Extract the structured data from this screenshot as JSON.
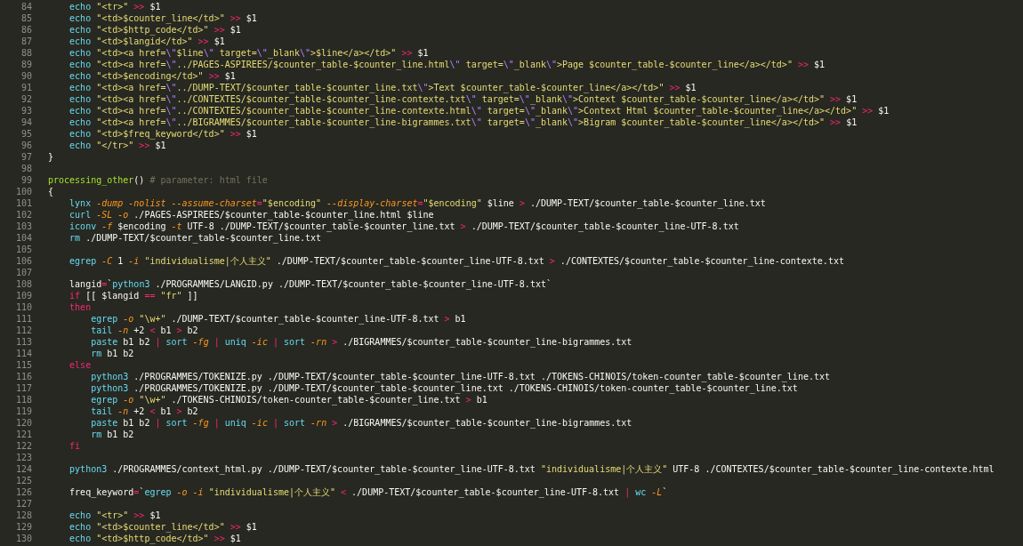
{
  "editor": {
    "lines": [
      {
        "number": "84",
        "tokens": [
          {
            "kind": "cmd",
            "text": "    echo"
          },
          {
            "kind": "str",
            "text": " \"<tr>\""
          },
          {
            "kind": "op",
            "text": " >>"
          },
          {
            "kind": "plain",
            "text": " $1"
          }
        ]
      },
      {
        "number": "85",
        "tokens": [
          {
            "kind": "cmd",
            "text": "    echo"
          },
          {
            "kind": "str",
            "text": " \"<td>$counter_line</td>\""
          },
          {
            "kind": "op",
            "text": " >>"
          },
          {
            "kind": "plain",
            "text": " $1"
          }
        ]
      },
      {
        "number": "86",
        "tokens": [
          {
            "kind": "cmd",
            "text": "    echo"
          },
          {
            "kind": "str",
            "text": " \"<td>$http_code</td>\""
          },
          {
            "kind": "op",
            "text": " >>"
          },
          {
            "kind": "plain",
            "text": " $1"
          }
        ]
      },
      {
        "number": "87",
        "tokens": [
          {
            "kind": "cmd",
            "text": "    echo"
          },
          {
            "kind": "str",
            "text": " \"<td>$langid</td>\""
          },
          {
            "kind": "op",
            "text": " >>"
          },
          {
            "kind": "plain",
            "text": " $1"
          }
        ]
      },
      {
        "number": "88",
        "tokens": [
          {
            "kind": "cmd",
            "text": "    echo"
          },
          {
            "kind": "str",
            "text": " \"<td><a href="
          },
          {
            "kind": "esc",
            "text": "\\\""
          },
          {
            "kind": "str",
            "text": "$line"
          },
          {
            "kind": "esc",
            "text": "\\\""
          },
          {
            "kind": "str",
            "text": " target="
          },
          {
            "kind": "esc",
            "text": "\\\""
          },
          {
            "kind": "str",
            "text": "_blank"
          },
          {
            "kind": "esc",
            "text": "\\\""
          },
          {
            "kind": "str",
            "text": ">$line</a></td>\""
          },
          {
            "kind": "op",
            "text": " >>"
          },
          {
            "kind": "plain",
            "text": " $1"
          }
        ]
      },
      {
        "number": "89",
        "tokens": [
          {
            "kind": "cmd",
            "text": "    echo"
          },
          {
            "kind": "str",
            "text": " \"<td><a href="
          },
          {
            "kind": "esc",
            "text": "\\\""
          },
          {
            "kind": "str",
            "text": "../PAGES-ASPIREES/$counter_table-$counter_line.html"
          },
          {
            "kind": "esc",
            "text": "\\\""
          },
          {
            "kind": "str",
            "text": " target="
          },
          {
            "kind": "esc",
            "text": "\\\""
          },
          {
            "kind": "str",
            "text": "_blank"
          },
          {
            "kind": "esc",
            "text": "\\\""
          },
          {
            "kind": "str",
            "text": ">Page $counter_table-$counter_line</a></td>\""
          },
          {
            "kind": "op",
            "text": " >>"
          },
          {
            "kind": "plain",
            "text": " $1"
          }
        ]
      },
      {
        "number": "90",
        "tokens": [
          {
            "kind": "cmd",
            "text": "    echo"
          },
          {
            "kind": "str",
            "text": " \"<td>$encoding</td>\""
          },
          {
            "kind": "op",
            "text": " >>"
          },
          {
            "kind": "plain",
            "text": " $1"
          }
        ]
      },
      {
        "number": "91",
        "tokens": [
          {
            "kind": "cmd",
            "text": "    echo"
          },
          {
            "kind": "str",
            "text": " \"<td><a href="
          },
          {
            "kind": "esc",
            "text": "\\\""
          },
          {
            "kind": "str",
            "text": "../DUMP-TEXT/$counter_table-$counter_line.txt"
          },
          {
            "kind": "esc",
            "text": "\\\""
          },
          {
            "kind": "str",
            "text": ">Text $counter_table-$counter_line</a></td>\""
          },
          {
            "kind": "op",
            "text": " >>"
          },
          {
            "kind": "plain",
            "text": " $1"
          }
        ]
      },
      {
        "number": "92",
        "tokens": [
          {
            "kind": "cmd",
            "text": "    echo"
          },
          {
            "kind": "str",
            "text": " \"<td><a href="
          },
          {
            "kind": "esc",
            "text": "\\\""
          },
          {
            "kind": "str",
            "text": "../CONTEXTES/$counter_table-$counter_line-contexte.txt"
          },
          {
            "kind": "esc",
            "text": "\\\""
          },
          {
            "kind": "str",
            "text": " target="
          },
          {
            "kind": "esc",
            "text": "\\\""
          },
          {
            "kind": "str",
            "text": "_blank"
          },
          {
            "kind": "esc",
            "text": "\\\""
          },
          {
            "kind": "str",
            "text": ">Context $counter_table-$counter_line</a></td>\""
          },
          {
            "kind": "op",
            "text": " >>"
          },
          {
            "kind": "plain",
            "text": " $1"
          }
        ]
      },
      {
        "number": "93",
        "tokens": [
          {
            "kind": "cmd",
            "text": "    echo"
          },
          {
            "kind": "str",
            "text": " \"<td><a href="
          },
          {
            "kind": "esc",
            "text": "\\\""
          },
          {
            "kind": "str",
            "text": "../CONTEXTES/$counter_table-$counter_line-contexte.html"
          },
          {
            "kind": "esc",
            "text": "\\\""
          },
          {
            "kind": "str",
            "text": " target="
          },
          {
            "kind": "esc",
            "text": "\\\""
          },
          {
            "kind": "str",
            "text": "_blank"
          },
          {
            "kind": "esc",
            "text": "\\\""
          },
          {
            "kind": "str",
            "text": ">Context Html $counter_table-$counter_line</a></td>\""
          },
          {
            "kind": "op",
            "text": " >>"
          },
          {
            "kind": "plain",
            "text": " $1"
          }
        ]
      },
      {
        "number": "94",
        "tokens": [
          {
            "kind": "cmd",
            "text": "    echo"
          },
          {
            "kind": "str",
            "text": " \"<td><a href="
          },
          {
            "kind": "esc",
            "text": "\\\""
          },
          {
            "kind": "str",
            "text": "../BIGRAMMES/$counter_table-$counter_line-bigrammes.txt"
          },
          {
            "kind": "esc",
            "text": "\\\""
          },
          {
            "kind": "str",
            "text": " target="
          },
          {
            "kind": "esc",
            "text": "\\\""
          },
          {
            "kind": "str",
            "text": "_blank"
          },
          {
            "kind": "esc",
            "text": "\\\""
          },
          {
            "kind": "str",
            "text": ">Bigram $counter_table-$counter_line</a></td>\""
          },
          {
            "kind": "op",
            "text": " >>"
          },
          {
            "kind": "plain",
            "text": " $1"
          }
        ]
      },
      {
        "number": "95",
        "tokens": [
          {
            "kind": "cmd",
            "text": "    echo"
          },
          {
            "kind": "str",
            "text": " \"<td>$freq_keyword</td>\""
          },
          {
            "kind": "op",
            "text": " >>"
          },
          {
            "kind": "plain",
            "text": " $1"
          }
        ]
      },
      {
        "number": "96",
        "tokens": [
          {
            "kind": "cmd",
            "text": "    echo"
          },
          {
            "kind": "str",
            "text": " \"</tr>\""
          },
          {
            "kind": "op",
            "text": " >>"
          },
          {
            "kind": "plain",
            "text": " $1"
          }
        ]
      },
      {
        "number": "97",
        "tokens": [
          {
            "kind": "plain",
            "text": "}"
          }
        ]
      },
      {
        "number": "98"
      },
      {
        "number": "99",
        "tokens": [
          {
            "kind": "fn",
            "text": "processing_other"
          },
          {
            "kind": "plain",
            "text": "() "
          },
          {
            "kind": "comment",
            "text": "# parameter: html file"
          }
        ]
      },
      {
        "number": "100",
        "tokens": [
          {
            "kind": "plain",
            "text": "{"
          }
        ]
      },
      {
        "number": "101",
        "tokens": [
          {
            "kind": "cmd",
            "text": "    lynx"
          },
          {
            "kind": "flag",
            "text": " -dump -nolist --assume-charset"
          },
          {
            "kind": "op",
            "text": "="
          },
          {
            "kind": "str",
            "text": "\"$encoding\""
          },
          {
            "kind": "flag",
            "text": " --display-charset"
          },
          {
            "kind": "op",
            "text": "="
          },
          {
            "kind": "str",
            "text": "\"$encoding\""
          },
          {
            "kind": "plain",
            "text": " $line "
          },
          {
            "kind": "op",
            "text": ">"
          },
          {
            "kind": "plain",
            "text": " ./DUMP-TEXT/$counter_table-$counter_line.txt"
          }
        ]
      },
      {
        "number": "102",
        "tokens": [
          {
            "kind": "cmd",
            "text": "    curl"
          },
          {
            "kind": "flag",
            "text": " -SL -o"
          },
          {
            "kind": "plain",
            "text": " ./PAGES-ASPIREES/$counter_table-$counter_line.html $line"
          }
        ]
      },
      {
        "number": "103",
        "tokens": [
          {
            "kind": "cmd",
            "text": "    iconv"
          },
          {
            "kind": "flag",
            "text": " -f"
          },
          {
            "kind": "plain",
            "text": " $encoding "
          },
          {
            "kind": "flag",
            "text": "-t"
          },
          {
            "kind": "plain",
            "text": " UTF-8 ./DUMP-TEXT/$counter_table-$counter_line.txt "
          },
          {
            "kind": "op",
            "text": ">"
          },
          {
            "kind": "plain",
            "text": " ./DUMP-TEXT/$counter_table-$counter_line-UTF-8.txt"
          }
        ]
      },
      {
        "number": "104",
        "tokens": [
          {
            "kind": "cmd",
            "text": "    rm"
          },
          {
            "kind": "plain",
            "text": " ./DUMP-TEXT/$counter_table-$counter_line.txt"
          }
        ]
      },
      {
        "number": "105"
      },
      {
        "number": "106",
        "tokens": [
          {
            "kind": "cmd",
            "text": "    egrep"
          },
          {
            "kind": "flag",
            "text": " -C"
          },
          {
            "kind": "plain",
            "text": " 1 "
          },
          {
            "kind": "flag",
            "text": "-i"
          },
          {
            "kind": "str",
            "text": " \"individualisme|个人主义\""
          },
          {
            "kind": "plain",
            "text": " ./DUMP-TEXT/$counter_table-$counter_line-UTF-8.txt "
          },
          {
            "kind": "op",
            "text": ">"
          },
          {
            "kind": "plain",
            "text": " ./CONTEXTES/$counter_table-$counter_line-contexte.txt"
          }
        ]
      },
      {
        "number": "107"
      },
      {
        "number": "108",
        "tokens": [
          {
            "kind": "plain",
            "text": "    langid"
          },
          {
            "kind": "op",
            "text": "="
          },
          {
            "kind": "plain",
            "text": "`"
          },
          {
            "kind": "cmd",
            "text": "python3"
          },
          {
            "kind": "plain",
            "text": " ./PROGRAMMES/LANGID.py ./DUMP-TEXT/$counter_table-$counter_line-UTF-8.txt`"
          }
        ]
      },
      {
        "number": "109",
        "tokens": [
          {
            "kind": "kw",
            "text": "    if"
          },
          {
            "kind": "plain",
            "text": " [[ $langid "
          },
          {
            "kind": "op",
            "text": "=="
          },
          {
            "kind": "str",
            "text": " \"fr\""
          },
          {
            "kind": "plain",
            "text": " ]]"
          }
        ]
      },
      {
        "number": "110",
        "tokens": [
          {
            "kind": "kw",
            "text": "    then"
          }
        ]
      },
      {
        "number": "111",
        "tokens": [
          {
            "kind": "cmd",
            "text": "        egrep"
          },
          {
            "kind": "flag",
            "text": " -o"
          },
          {
            "kind": "str",
            "text": " \"\\w+\""
          },
          {
            "kind": "plain",
            "text": " ./DUMP-TEXT/$counter_table-$counter_line-UTF-8.txt "
          },
          {
            "kind": "op",
            "text": ">"
          },
          {
            "kind": "plain",
            "text": " b1"
          }
        ]
      },
      {
        "number": "112",
        "tokens": [
          {
            "kind": "cmd",
            "text": "        tail"
          },
          {
            "kind": "flag",
            "text": " -n"
          },
          {
            "kind": "plain",
            "text": " +2 "
          },
          {
            "kind": "op",
            "text": "<"
          },
          {
            "kind": "plain",
            "text": " b1 "
          },
          {
            "kind": "op",
            "text": ">"
          },
          {
            "kind": "plain",
            "text": " b2"
          }
        ]
      },
      {
        "number": "113",
        "tokens": [
          {
            "kind": "cmd",
            "text": "        paste"
          },
          {
            "kind": "plain",
            "text": " b1 b2 "
          },
          {
            "kind": "op",
            "text": "|"
          },
          {
            "kind": "cmd",
            "text": " sort"
          },
          {
            "kind": "flag",
            "text": " -fg "
          },
          {
            "kind": "op",
            "text": "|"
          },
          {
            "kind": "cmd",
            "text": " uniq"
          },
          {
            "kind": "flag",
            "text": " -ic "
          },
          {
            "kind": "op",
            "text": "|"
          },
          {
            "kind": "cmd",
            "text": " sort"
          },
          {
            "kind": "flag",
            "text": " -rn "
          },
          {
            "kind": "op",
            "text": ">"
          },
          {
            "kind": "plain",
            "text": " ./BIGRAMMES/$counter_table-$counter_line-bigrammes.txt"
          }
        ]
      },
      {
        "number": "114",
        "tokens": [
          {
            "kind": "cmd",
            "text": "        rm"
          },
          {
            "kind": "plain",
            "text": " b1 b2"
          }
        ]
      },
      {
        "number": "115",
        "tokens": [
          {
            "kind": "kw",
            "text": "    else"
          }
        ]
      },
      {
        "number": "116",
        "tokens": [
          {
            "kind": "cmd",
            "text": "        python3"
          },
          {
            "kind": "plain",
            "text": " ./PROGRAMMES/TOKENIZE.py ./DUMP-TEXT/$counter_table-$counter_line-UTF-8.txt ./TOKENS-CHINOIS/token-counter_table-$counter_line.txt"
          }
        ]
      },
      {
        "number": "117",
        "tokens": [
          {
            "kind": "cmd",
            "text": "        python3"
          },
          {
            "kind": "plain",
            "text": " ./PROGRAMMES/TOKENIZE.py ./DUMP-TEXT/$counter_table-$counter_line.txt ./TOKENS-CHINOIS/token-counter_table-$counter_line.txt"
          }
        ]
      },
      {
        "number": "118",
        "tokens": [
          {
            "kind": "cmd",
            "text": "        egrep"
          },
          {
            "kind": "flag",
            "text": " -o"
          },
          {
            "kind": "str",
            "text": " \"\\w+\""
          },
          {
            "kind": "plain",
            "text": " ./TOKENS-CHINOIS/token-counter_table-$counter_line.txt "
          },
          {
            "kind": "op",
            "text": ">"
          },
          {
            "kind": "plain",
            "text": " b1"
          }
        ]
      },
      {
        "number": "119",
        "tokens": [
          {
            "kind": "cmd",
            "text": "        tail"
          },
          {
            "kind": "flag",
            "text": " -n"
          },
          {
            "kind": "plain",
            "text": " +2 "
          },
          {
            "kind": "op",
            "text": "<"
          },
          {
            "kind": "plain",
            "text": " b1 "
          },
          {
            "kind": "op",
            "text": ">"
          },
          {
            "kind": "plain",
            "text": " b2"
          }
        ]
      },
      {
        "number": "120",
        "tokens": [
          {
            "kind": "cmd",
            "text": "        paste"
          },
          {
            "kind": "plain",
            "text": " b1 b2 "
          },
          {
            "kind": "op",
            "text": "|"
          },
          {
            "kind": "cmd",
            "text": " sort"
          },
          {
            "kind": "flag",
            "text": " -fg "
          },
          {
            "kind": "op",
            "text": "|"
          },
          {
            "kind": "cmd",
            "text": " uniq"
          },
          {
            "kind": "flag",
            "text": " -ic "
          },
          {
            "kind": "op",
            "text": "|"
          },
          {
            "kind": "cmd",
            "text": " sort"
          },
          {
            "kind": "flag",
            "text": " -rn "
          },
          {
            "kind": "op",
            "text": ">"
          },
          {
            "kind": "plain",
            "text": " ./BIGRAMMES/$counter_table-$counter_line-bigrammes.txt"
          }
        ]
      },
      {
        "number": "121",
        "tokens": [
          {
            "kind": "cmd",
            "text": "        rm"
          },
          {
            "kind": "plain",
            "text": " b1 b2"
          }
        ]
      },
      {
        "number": "122",
        "tokens": [
          {
            "kind": "kw",
            "text": "    fi"
          }
        ]
      },
      {
        "number": "123"
      },
      {
        "number": "124",
        "tokens": [
          {
            "kind": "cmd",
            "text": "    python3"
          },
          {
            "kind": "plain",
            "text": " ./PROGRAMMES/context_html.py ./DUMP-TEXT/$counter_table-$counter_line-UTF-8.txt "
          },
          {
            "kind": "str",
            "text": "\"individualisme|个人主义\""
          },
          {
            "kind": "plain",
            "text": " UTF-8 ./CONTEXTES/$counter_table-$counter_line-contexte.html"
          }
        ]
      },
      {
        "number": "125"
      },
      {
        "number": "126",
        "tokens": [
          {
            "kind": "plain",
            "text": "    freq_keyword"
          },
          {
            "kind": "op",
            "text": "="
          },
          {
            "kind": "plain",
            "text": "`"
          },
          {
            "kind": "cmd",
            "text": "egrep"
          },
          {
            "kind": "flag",
            "text": " -o -i"
          },
          {
            "kind": "str",
            "text": " \"individualisme|个人主义\""
          },
          {
            "kind": "op",
            "text": " <"
          },
          {
            "kind": "plain",
            "text": " ./DUMP-TEXT/$counter_table-$counter_line-UTF-8.txt "
          },
          {
            "kind": "op",
            "text": "|"
          },
          {
            "kind": "cmd",
            "text": " wc"
          },
          {
            "kind": "flag",
            "text": " -L"
          },
          {
            "kind": "plain",
            "text": "`"
          }
        ]
      },
      {
        "number": "127"
      },
      {
        "number": "128",
        "tokens": [
          {
            "kind": "cmd",
            "text": "    echo"
          },
          {
            "kind": "str",
            "text": " \"<tr>\""
          },
          {
            "kind": "op",
            "text": " >>"
          },
          {
            "kind": "plain",
            "text": " $1"
          }
        ]
      },
      {
        "number": "129",
        "tokens": [
          {
            "kind": "cmd",
            "text": "    echo"
          },
          {
            "kind": "str",
            "text": " \"<td>$counter_line</td>\""
          },
          {
            "kind": "op",
            "text": " >>"
          },
          {
            "kind": "plain",
            "text": " $1"
          }
        ]
      },
      {
        "number": "130",
        "tokens": [
          {
            "kind": "cmd",
            "text": "    echo"
          },
          {
            "kind": "str",
            "text": " \"<td>$http_code</td>\""
          },
          {
            "kind": "op",
            "text": " >>"
          },
          {
            "kind": "plain",
            "text": " $1"
          }
        ]
      }
    ]
  }
}
